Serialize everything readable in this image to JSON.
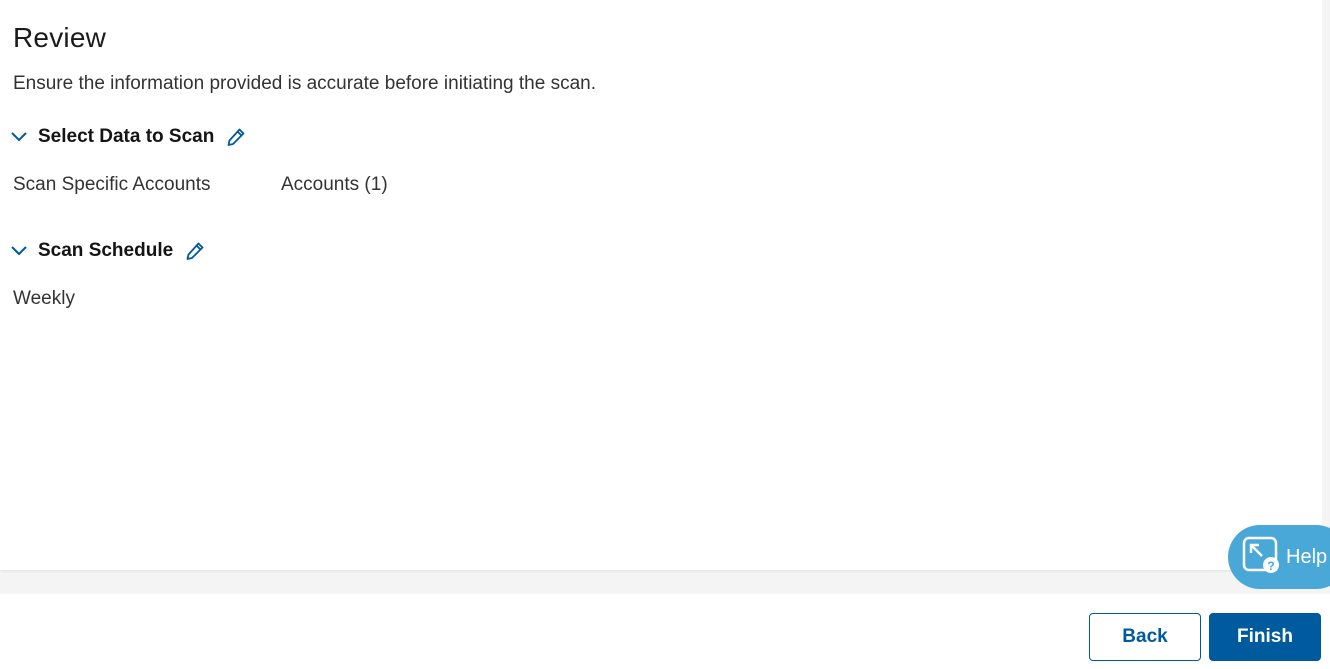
{
  "review": {
    "title": "Review",
    "subtitle": "Ensure the information provided is accurate before initiating the scan."
  },
  "sections": {
    "data_to_scan": {
      "title": "Select Data to Scan",
      "scope_label": "Scan Specific Accounts",
      "accounts_value": "Accounts (1)"
    },
    "schedule": {
      "title": "Scan Schedule",
      "frequency": "Weekly"
    }
  },
  "footer": {
    "back_label": "Back",
    "finish_label": "Finish"
  },
  "help": {
    "label": "Help"
  },
  "colors": {
    "accent": "#005a9e",
    "help_bg": "#4aa8d8"
  },
  "icons": {
    "collapse": "chevron-down-icon",
    "edit": "pencil-icon",
    "help": "help-expand-icon"
  }
}
